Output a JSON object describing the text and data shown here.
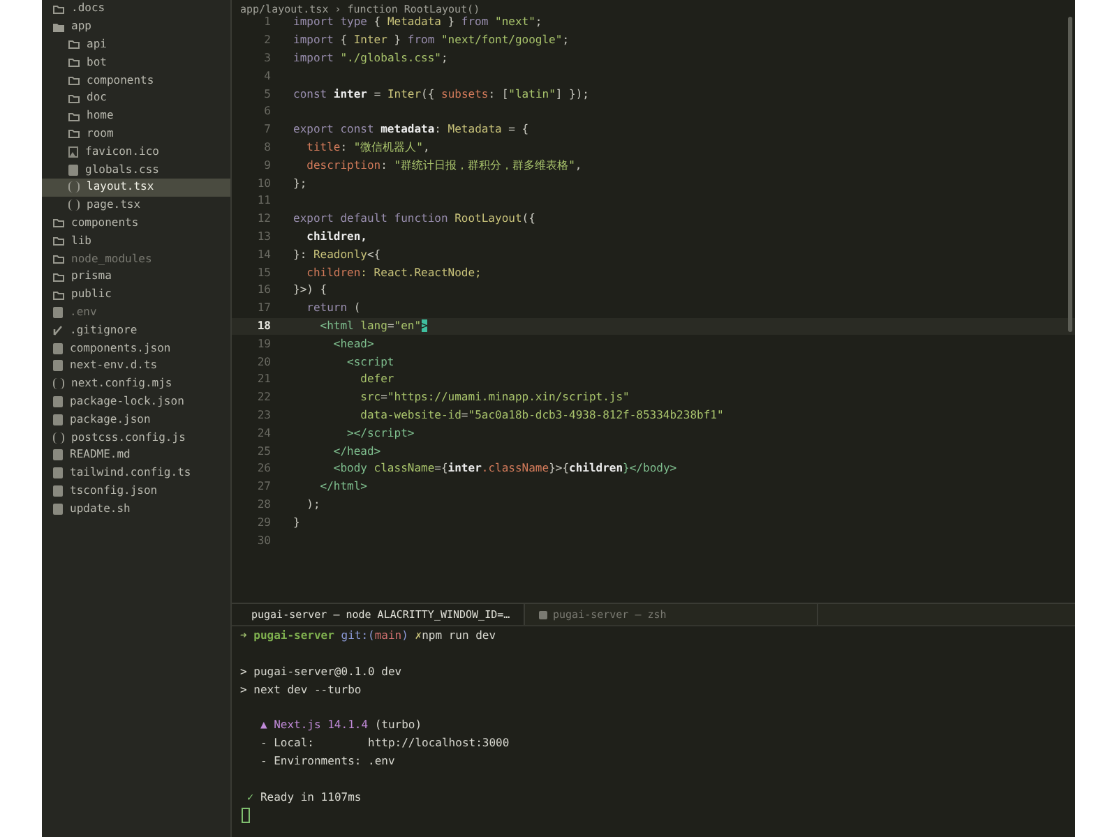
{
  "sidebar": {
    "items": [
      {
        "name": ".docs",
        "kind": "folder",
        "selected": false,
        "ignored": false
      },
      {
        "name": "app",
        "kind": "folder",
        "expanded": true,
        "selected": false,
        "ignored": false,
        "children": [
          {
            "name": "api",
            "kind": "folder",
            "selected": false,
            "ignored": false
          },
          {
            "name": "bot",
            "kind": "folder",
            "selected": false,
            "ignored": false
          },
          {
            "name": "components",
            "kind": "folder",
            "selected": false,
            "ignored": false
          },
          {
            "name": "doc",
            "kind": "folder",
            "selected": false,
            "ignored": false
          },
          {
            "name": "home",
            "kind": "folder",
            "selected": false,
            "ignored": false
          },
          {
            "name": "room",
            "kind": "folder",
            "selected": false,
            "ignored": false
          },
          {
            "name": "favicon.ico",
            "kind": "image",
            "selected": false,
            "ignored": false
          },
          {
            "name": "globals.css",
            "kind": "file",
            "selected": false,
            "ignored": false
          },
          {
            "name": "layout.tsx",
            "kind": "code",
            "selected": true,
            "ignored": false
          },
          {
            "name": "page.tsx",
            "kind": "code",
            "selected": false,
            "ignored": false
          }
        ]
      },
      {
        "name": "components",
        "kind": "folder",
        "selected": false,
        "ignored": false
      },
      {
        "name": "lib",
        "kind": "folder",
        "selected": false,
        "ignored": false
      },
      {
        "name": "node_modules",
        "kind": "folder",
        "selected": false,
        "ignored": true
      },
      {
        "name": "prisma",
        "kind": "folder",
        "selected": false,
        "ignored": false
      },
      {
        "name": "public",
        "kind": "folder",
        "selected": false,
        "ignored": false
      },
      {
        "name": ".env",
        "kind": "file",
        "selected": false,
        "ignored": true
      },
      {
        "name": ".gitignore",
        "kind": "git",
        "selected": false,
        "ignored": false
      },
      {
        "name": "components.json",
        "kind": "file",
        "selected": false,
        "ignored": false
      },
      {
        "name": "next-env.d.ts",
        "kind": "file",
        "selected": false,
        "ignored": false
      },
      {
        "name": "next.config.mjs",
        "kind": "code",
        "selected": false,
        "ignored": false
      },
      {
        "name": "package-lock.json",
        "kind": "file",
        "selected": false,
        "ignored": false
      },
      {
        "name": "package.json",
        "kind": "file",
        "selected": false,
        "ignored": false
      },
      {
        "name": "postcss.config.js",
        "kind": "code",
        "selected": false,
        "ignored": false
      },
      {
        "name": "README.md",
        "kind": "file",
        "selected": false,
        "ignored": false
      },
      {
        "name": "tailwind.config.ts",
        "kind": "file",
        "selected": false,
        "ignored": false
      },
      {
        "name": "tsconfig.json",
        "kind": "file",
        "selected": false,
        "ignored": false
      },
      {
        "name": "update.sh",
        "kind": "file",
        "selected": false,
        "ignored": false
      }
    ]
  },
  "editor": {
    "breadcrumb": "app/layout.tsx › function RootLayout()",
    "lines": [
      {
        "number": "1",
        "current": false,
        "tokens": [
          {
            "text": "import type",
            "kind": "kw"
          },
          {
            "text": " { ",
            "kind": "plain"
          },
          {
            "text": "Metadata",
            "kind": "type"
          },
          {
            "text": " } ",
            "kind": "plain"
          },
          {
            "text": "from",
            "kind": "kw"
          },
          {
            "text": " \"next\"",
            "kind": "str"
          },
          {
            "text": ";",
            "kind": "plain"
          }
        ]
      },
      {
        "number": "2",
        "current": false,
        "tokens": [
          {
            "text": "import",
            "kind": "kw"
          },
          {
            "text": " { ",
            "kind": "plain"
          },
          {
            "text": "Inter",
            "kind": "type"
          },
          {
            "text": " } ",
            "kind": "plain"
          },
          {
            "text": "from",
            "kind": "kw"
          },
          {
            "text": " \"next/font/google\"",
            "kind": "str"
          },
          {
            "text": ";",
            "kind": "plain"
          }
        ]
      },
      {
        "number": "3",
        "current": false,
        "tokens": [
          {
            "text": "import",
            "kind": "kw"
          },
          {
            "text": " \"./globals.css\"",
            "kind": "str"
          },
          {
            "text": ";",
            "kind": "plain"
          }
        ]
      },
      {
        "number": "4",
        "current": false
      },
      {
        "number": "5",
        "current": false,
        "tokens": [
          {
            "text": "const",
            "kind": "kw"
          },
          {
            "text": " inter ",
            "kind": "bold"
          },
          {
            "text": "= ",
            "kind": "plain"
          },
          {
            "text": "Inter",
            "kind": "type"
          },
          {
            "text": "({ ",
            "kind": "plain"
          },
          {
            "text": "subsets",
            "kind": "prop"
          },
          {
            "text": ": [",
            "kind": "plain"
          },
          {
            "text": "\"latin\"",
            "kind": "str"
          },
          {
            "text": "] });",
            "kind": "plain"
          }
        ]
      },
      {
        "number": "6",
        "current": false
      },
      {
        "number": "7",
        "current": false,
        "tokens": [
          {
            "text": "export const",
            "kind": "kw"
          },
          {
            "text": " metadata",
            "kind": "bold"
          },
          {
            "text": ": ",
            "kind": "plain"
          },
          {
            "text": "Metadata",
            "kind": "type"
          },
          {
            "text": " = {",
            "kind": "plain"
          }
        ]
      },
      {
        "number": "8",
        "current": false,
        "tokens": [
          {
            "text": "  title",
            "kind": "prop"
          },
          {
            "text": ": ",
            "kind": "plain"
          },
          {
            "text": "\"微信机器人\"",
            "kind": "str"
          },
          {
            "text": ",",
            "kind": "plain"
          }
        ]
      },
      {
        "number": "9",
        "current": false,
        "tokens": [
          {
            "text": "  description",
            "kind": "prop"
          },
          {
            "text": ": ",
            "kind": "plain"
          },
          {
            "text": "\"群统计日报，群积分，群多维表格\"",
            "kind": "str"
          },
          {
            "text": ",",
            "kind": "plain"
          }
        ]
      },
      {
        "number": "10",
        "current": false,
        "tokens": [
          {
            "text": "};",
            "kind": "plain"
          }
        ]
      },
      {
        "number": "11",
        "current": false
      },
      {
        "number": "12",
        "current": false,
        "tokens": [
          {
            "text": "export default function",
            "kind": "kw"
          },
          {
            "text": " RootLayout",
            "kind": "type"
          },
          {
            "text": "({",
            "kind": "plain"
          }
        ]
      },
      {
        "number": "13",
        "current": false,
        "tokens": [
          {
            "text": "  children,",
            "kind": "bold"
          }
        ]
      },
      {
        "number": "14",
        "current": false,
        "tokens": [
          {
            "text": "}: ",
            "kind": "plain"
          },
          {
            "text": "Readonly",
            "kind": "type"
          },
          {
            "text": "<{",
            "kind": "plain"
          }
        ]
      },
      {
        "number": "15",
        "current": false,
        "tokens": [
          {
            "text": "  children",
            "kind": "prop"
          },
          {
            "text": ": React.ReactNode;",
            "kind": "type"
          }
        ]
      },
      {
        "number": "16",
        "current": false,
        "tokens": [
          {
            "text": "}>) {",
            "kind": "plain"
          }
        ]
      },
      {
        "number": "17",
        "current": false,
        "tokens": [
          {
            "text": "  return",
            "kind": "kw"
          },
          {
            "text": " (",
            "kind": "plain"
          }
        ]
      },
      {
        "number": "18",
        "current": true,
        "tokens": [
          {
            "text": "    <html ",
            "kind": "tag"
          },
          {
            "text": "lang",
            "kind": "attr"
          },
          {
            "text": "=",
            "kind": "plain"
          },
          {
            "text": "\"en\"",
            "kind": "str"
          },
          {
            "text": ">",
            "kind": "cursor"
          }
        ]
      },
      {
        "number": "19",
        "current": false,
        "tokens": [
          {
            "text": "      <head>",
            "kind": "tag"
          }
        ]
      },
      {
        "number": "20",
        "current": false,
        "tokens": [
          {
            "text": "        <script",
            "kind": "tag"
          }
        ]
      },
      {
        "number": "21",
        "current": false,
        "tokens": [
          {
            "text": "          defer",
            "kind": "attr"
          }
        ]
      },
      {
        "number": "22",
        "current": false,
        "tokens": [
          {
            "text": "          src",
            "kind": "attr"
          },
          {
            "text": "=",
            "kind": "plain"
          },
          {
            "text": "\"https://umami.minapp.xin/script.js\"",
            "kind": "str"
          }
        ]
      },
      {
        "number": "23",
        "current": false,
        "tokens": [
          {
            "text": "          data-website-id",
            "kind": "attr"
          },
          {
            "text": "=",
            "kind": "plain"
          },
          {
            "text": "\"5ac0a18b-dcb3-4938-812f-85334b238bf1\"",
            "kind": "str"
          }
        ]
      },
      {
        "number": "24",
        "current": false,
        "tokens": [
          {
            "text": "        ></script>",
            "kind": "tag"
          }
        ]
      },
      {
        "number": "25",
        "current": false,
        "tokens": [
          {
            "text": "      </head>",
            "kind": "tag"
          }
        ]
      },
      {
        "number": "26",
        "current": false,
        "tokens": [
          {
            "text": "      <body ",
            "kind": "tag"
          },
          {
            "text": "className",
            "kind": "attr"
          },
          {
            "text": "={",
            "kind": "plain"
          },
          {
            "text": "inter",
            "kind": "bold"
          },
          {
            "text": ".className",
            "kind": "prop"
          },
          {
            "text": "}>{",
            "kind": "plain"
          },
          {
            "text": "children",
            "kind": "bold"
          },
          {
            "text": "}</body>",
            "kind": "tag"
          }
        ]
      },
      {
        "number": "27",
        "current": false,
        "tokens": [
          {
            "text": "    </html>",
            "kind": "tag"
          }
        ]
      },
      {
        "number": "28",
        "current": false,
        "tokens": [
          {
            "text": "  );",
            "kind": "plain"
          }
        ]
      },
      {
        "number": "29",
        "current": false,
        "tokens": [
          {
            "text": "}",
            "kind": "plain"
          }
        ]
      },
      {
        "number": "30",
        "current": false
      }
    ]
  },
  "terminal": {
    "tabs": [
      {
        "label": "pugai-server — node ALACRITTY_WINDOW_ID=…",
        "selected": true
      },
      {
        "label": "pugai-server — zsh",
        "selected": false
      }
    ],
    "lines": [
      {
        "kind": "prompt",
        "tokens": [
          {
            "text": "➜ ",
            "kind": "arrow"
          },
          {
            "text": "pugai-server",
            "kind": "dir"
          },
          {
            "text": " git:(",
            "kind": "git"
          },
          {
            "text": "main",
            "kind": "branch"
          },
          {
            "text": ") ",
            "kind": "git"
          },
          {
            "text": "✗",
            "kind": "dirty"
          },
          {
            "text": "npm run dev",
            "kind": "plain"
          }
        ]
      },
      {
        "kind": "blank"
      },
      {
        "kind": "text",
        "tokens": [
          {
            "text": "> pugai-server@0.1.0 dev",
            "kind": "plain"
          }
        ]
      },
      {
        "kind": "text",
        "tokens": [
          {
            "text": "> next dev --turbo",
            "kind": "plain"
          }
        ]
      },
      {
        "kind": "blank"
      },
      {
        "kind": "text",
        "tokens": [
          {
            "text": "   ▲ Next.js 14.1.4",
            "kind": "brand"
          },
          {
            "text": " (turbo)",
            "kind": "plain"
          }
        ]
      },
      {
        "kind": "text",
        "tokens": [
          {
            "text": "   - Local:        http://localhost:3000",
            "kind": "plain"
          }
        ]
      },
      {
        "kind": "text",
        "tokens": [
          {
            "text": "   - Environments: .env",
            "kind": "plain"
          }
        ]
      },
      {
        "kind": "blank"
      },
      {
        "kind": "text",
        "tokens": [
          {
            "text": " ✓",
            "kind": "ok"
          },
          {
            "text": " Ready in 1107ms",
            "kind": "plain"
          }
        ]
      },
      {
        "kind": "cursor"
      }
    ]
  }
}
